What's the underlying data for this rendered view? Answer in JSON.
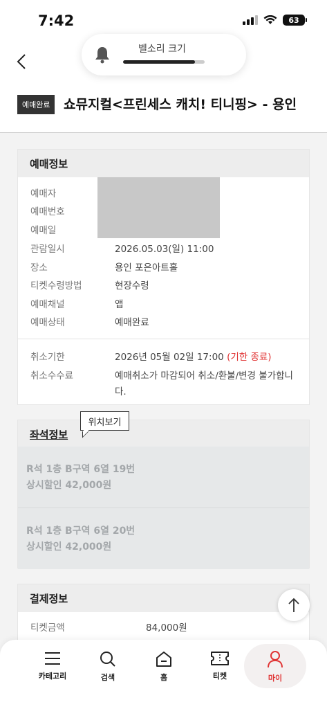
{
  "status_bar": {
    "time": "7:42",
    "battery": "63"
  },
  "volume_hud": {
    "label": "벨소리 크기",
    "level": 0.88
  },
  "header": {
    "status_chip": "예매완료",
    "title": "쇼뮤지컬<프린세스 캐치! 티니핑> - 용인"
  },
  "booking_info": {
    "heading": "예매정보",
    "rows": [
      {
        "label": "예매자",
        "value": ""
      },
      {
        "label": "예매번호",
        "value": ""
      },
      {
        "label": "예매일",
        "value": ""
      },
      {
        "label": "관람일시",
        "value": "2026.05.03(일) 11:00"
      },
      {
        "label": "장소",
        "value": "용인 포은아트홀"
      },
      {
        "label": "티켓수령방법",
        "value": "현장수령"
      },
      {
        "label": "예매채널",
        "value": "앱"
      },
      {
        "label": "예매상태",
        "value": "예매완료"
      }
    ],
    "cancel_deadline_label": "취소기한",
    "cancel_deadline_value": "2026년 05월 02일 17:00",
    "cancel_deadline_note": "(기한 종료)",
    "cancel_fee_label": "취소수수료",
    "cancel_fee_line1": "예매취소가 마감되어 취소/환불/변경 불가합니",
    "cancel_fee_line2": "다."
  },
  "seat_info": {
    "heading": "좌석정보",
    "tooltip": "위치보기",
    "seats": [
      {
        "seat": "R석 1층 B구역 6열 19번",
        "price": "상시할인 42,000원"
      },
      {
        "seat": "R석 1층 B구역 6열 20번",
        "price": "상시할인 42,000원"
      }
    ]
  },
  "payment_info": {
    "heading": "결제정보",
    "ticket_amount_label": "티켓금액",
    "ticket_amount_value": "84,000원"
  },
  "bottom_nav": {
    "items": [
      {
        "label": "카테고리",
        "icon": "menu-icon"
      },
      {
        "label": "검색",
        "icon": "search-icon"
      },
      {
        "label": "홈",
        "icon": "home-icon"
      },
      {
        "label": "티켓",
        "icon": "ticket-icon"
      },
      {
        "label": "마이",
        "icon": "user-icon"
      }
    ],
    "active": "마이"
  },
  "colors": {
    "accent_red": "#e03333",
    "chip_bg": "#333333"
  }
}
